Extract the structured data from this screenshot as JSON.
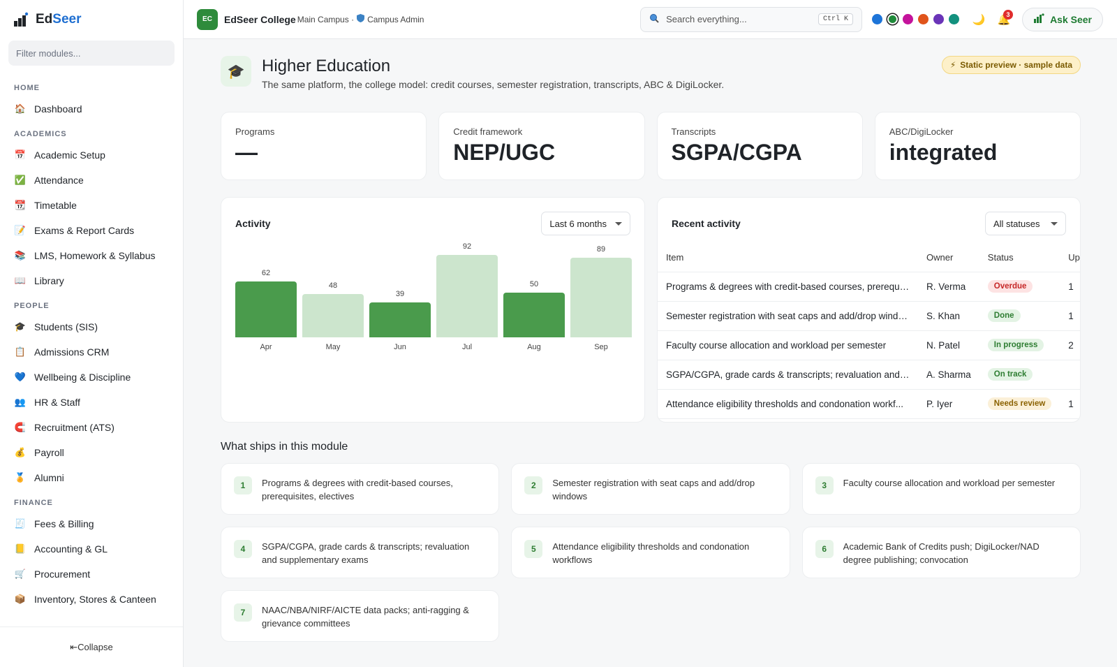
{
  "sidebar": {
    "brand": {
      "prefix": "Ed",
      "suffix": "Seer"
    },
    "filter_placeholder": "Filter modules...",
    "sections": [
      {
        "title": "HOME",
        "items": [
          {
            "label": "Dashboard",
            "icon": "house-icon",
            "glyph": "🏠"
          }
        ]
      },
      {
        "title": "ACADEMICS",
        "items": [
          {
            "label": "Academic Setup",
            "icon": "calendar-icon",
            "glyph": "📅"
          },
          {
            "label": "Attendance",
            "icon": "check-box-icon",
            "glyph": "✅"
          },
          {
            "label": "Timetable",
            "icon": "calendar-grid-icon",
            "glyph": "📆"
          },
          {
            "label": "Exams & Report Cards",
            "icon": "memo-icon",
            "glyph": "📝"
          },
          {
            "label": "LMS, Homework & Syllabus",
            "icon": "books-icon",
            "glyph": "📚"
          },
          {
            "label": "Library",
            "icon": "open-book-icon",
            "glyph": "📖"
          }
        ]
      },
      {
        "title": "PEOPLE",
        "items": [
          {
            "label": "Students (SIS)",
            "icon": "graduation-cap-icon",
            "glyph": "🎓"
          },
          {
            "label": "Admissions CRM",
            "icon": "clipboard-icon",
            "glyph": "📋"
          },
          {
            "label": "Wellbeing & Discipline",
            "icon": "heart-icon",
            "glyph": "💙"
          },
          {
            "label": "HR & Staff",
            "icon": "people-icon",
            "glyph": "👥"
          },
          {
            "label": "Recruitment (ATS)",
            "icon": "magnet-icon",
            "glyph": "🧲"
          },
          {
            "label": "Payroll",
            "icon": "money-bag-icon",
            "glyph": "💰"
          },
          {
            "label": "Alumni",
            "icon": "medal-icon",
            "glyph": "🏅"
          }
        ]
      },
      {
        "title": "FINANCE",
        "items": [
          {
            "label": "Fees & Billing",
            "icon": "receipt-icon",
            "glyph": "🧾"
          },
          {
            "label": "Accounting & GL",
            "icon": "ledger-icon",
            "glyph": "📒"
          },
          {
            "label": "Procurement",
            "icon": "cart-icon",
            "glyph": "🛒"
          },
          {
            "label": "Inventory, Stores & Canteen",
            "icon": "package-icon",
            "glyph": "📦"
          }
        ]
      }
    ],
    "collapse_label": "⇤Collapse"
  },
  "topbar": {
    "org_initials": "EC",
    "org_name": "EdSeer College",
    "campus": "Main Campus ·",
    "role": "Campus Admin",
    "search_placeholder": "Search everything...",
    "search_shortcut": "Ctrl K",
    "theme_swatches": [
      {
        "name": "blue",
        "color": "#1d74d8",
        "active": false
      },
      {
        "name": "green",
        "color": "#1f8a3a",
        "active": true
      },
      {
        "name": "magenta",
        "color": "#c4139b",
        "active": false
      },
      {
        "name": "orange",
        "color": "#e0541b",
        "active": false
      },
      {
        "name": "purple",
        "color": "#6a34b8",
        "active": false
      },
      {
        "name": "teal",
        "color": "#13917e",
        "active": false
      }
    ],
    "notification_count": "3",
    "ask_label": "Ask Seer"
  },
  "page": {
    "title": "Higher Education",
    "subtitle": "The same platform, the college model: credit courses, semester registration, transcripts, ABC & DigiLocker.",
    "preview_chip": "Static preview · sample data"
  },
  "stats": [
    {
      "label": "Programs",
      "value": "—"
    },
    {
      "label": "Credit framework",
      "value": "NEP/UGC"
    },
    {
      "label": "Transcripts",
      "value": "SGPA/CGPA"
    },
    {
      "label": "ABC/DigiLocker",
      "value": "integrated"
    }
  ],
  "activity": {
    "title": "Activity",
    "range_select": "Last 6 months"
  },
  "chart_data": {
    "type": "bar",
    "title": "Activity",
    "categories": [
      "Apr",
      "May",
      "Jun",
      "Jul",
      "Aug",
      "Sep"
    ],
    "values": [
      62,
      48,
      39,
      92,
      50,
      89
    ],
    "ylim": [
      0,
      92
    ],
    "colors": [
      "#4a9b4c",
      "#cce5cd",
      "#4a9b4c",
      "#cce5cd",
      "#4a9b4c",
      "#cce5cd"
    ],
    "data_labels": true,
    "grid": false,
    "xlabel": "",
    "ylabel": ""
  },
  "recent": {
    "title": "Recent activity",
    "status_filter": "All statuses",
    "columns": [
      "Item",
      "Owner",
      "Status",
      "Up"
    ],
    "rows": [
      {
        "item": "Programs & degrees with credit-based courses, prerequis...",
        "owner": "R. Verma",
        "status": "Overdue",
        "status_bg": "#fde3e3",
        "status_fg": "#c62828",
        "extra": "1"
      },
      {
        "item": "Semester registration with seat caps and add/drop windows",
        "owner": "S. Khan",
        "status": "Done",
        "status_bg": "#e3f3e4",
        "status_fg": "#2e7d32",
        "extra": "1"
      },
      {
        "item": "Faculty course allocation and workload per semester",
        "owner": "N. Patel",
        "status": "In progress",
        "status_bg": "#e3f3e4",
        "status_fg": "#2e7d32",
        "extra": "2"
      },
      {
        "item": "SGPA/CGPA, grade cards & transcripts; revaluation and s...",
        "owner": "A. Sharma",
        "status": "On track",
        "status_bg": "#e3f3e4",
        "status_fg": "#2e7d32",
        "extra": ""
      },
      {
        "item": "Attendance eligibility thresholds and condonation workf...",
        "owner": "P. Iyer",
        "status": "Needs review",
        "status_bg": "#fbf0d8",
        "status_fg": "#8a6100",
        "extra": "1"
      }
    ]
  },
  "features": {
    "title": "What ships in this module",
    "items": [
      {
        "n": "1",
        "text": "Programs & degrees with credit-based courses, prerequisites, electives"
      },
      {
        "n": "2",
        "text": "Semester registration with seat caps and add/drop windows"
      },
      {
        "n": "3",
        "text": "Faculty course allocation and workload per semester"
      },
      {
        "n": "4",
        "text": "SGPA/CGPA, grade cards & transcripts; revaluation and supplementary exams"
      },
      {
        "n": "5",
        "text": "Attendance eligibility thresholds and condonation workflows"
      },
      {
        "n": "6",
        "text": "Academic Bank of Credits push; DigiLocker/NAD degree publishing; convocation"
      },
      {
        "n": "7",
        "text": "NAAC/NBA/NIRF/AICTE data packs; anti-ragging & grievance committees"
      }
    ]
  }
}
